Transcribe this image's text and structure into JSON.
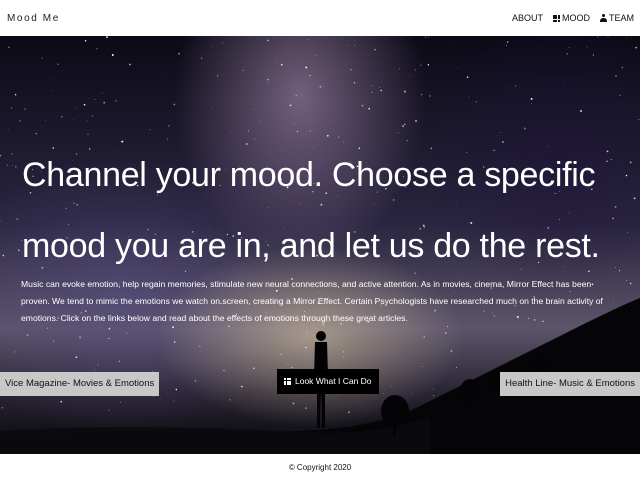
{
  "nav": {
    "brand": "Mood Me",
    "items": [
      {
        "label": "ABOUT",
        "icon": ""
      },
      {
        "label": "MOOD",
        "icon": "grid-icon"
      },
      {
        "label": "TEAM",
        "icon": "user-icon"
      }
    ]
  },
  "hero": {
    "headline": "Channel your mood. Choose a specific mood you are in, and let us do the rest.",
    "body": "Music can evoke emotion, help regain memories, stimulate new neural connections, and active attention. As in movies, cinema, Mirror Effect has been proven. We tend to mimic the emotions we watch on screen, creating a Mirror Effect. Certain Psychologists have researched much on the brain activity of emotions. Click on the links below and read about the effects of emotions through these great articles.",
    "left_link": "Vice Magazine- Movies & Emotions",
    "right_link": "Health Line- Music & Emotions",
    "cta_label": "Look What I Can Do",
    "cta_icon": "grid-icon"
  },
  "footer": {
    "copyright": "© Copyright 2020"
  }
}
